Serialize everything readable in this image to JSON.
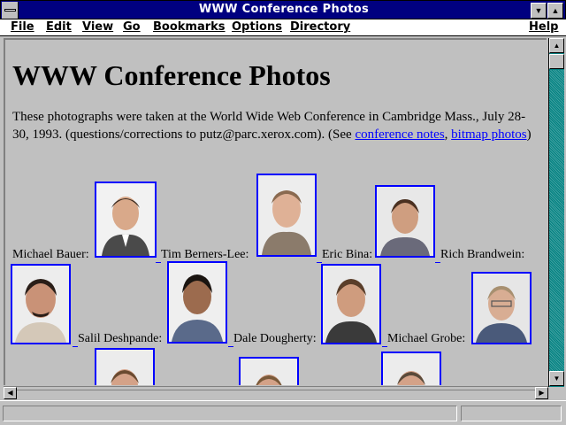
{
  "window": {
    "title": "WWW Conference Photos",
    "minimize_icon": "down-triangle",
    "maximize_icon": "up-triangle"
  },
  "menu": {
    "file": "File",
    "edit": "Edit",
    "view": "View",
    "go": "Go",
    "bookmarks": "Bookmarks",
    "options": "Options",
    "directory": "Directory",
    "help": "Help"
  },
  "page": {
    "heading": "WWW Conference Photos",
    "intro_text": "These photographs were taken at the World Wide Web Conference in Cambridge Mass., July 28-30, 1993. (questions/corrections to putz@parc.xerox.com). (See ",
    "link_conference_notes": "conference notes",
    "separator": ", ",
    "link_bitmap_photos": "bitmap photos",
    "closing_paren": ")"
  },
  "people": {
    "michael_bauer": "Michael Bauer:",
    "tim_berners_lee": "Tim Berners-Lee:",
    "eric_bina": "Eric Bina:",
    "rich_brandwein": "Rich Brandwein:",
    "salil_deshpande": "Salil Deshpande:",
    "dale_dougherty": "Dale Dougherty:",
    "michael_grobe": "Michael Grobe:"
  },
  "colors": {
    "title_bar": "#000080",
    "link": "#0000ff",
    "background": "#c0c0c0",
    "scrollbar": "#008080"
  }
}
